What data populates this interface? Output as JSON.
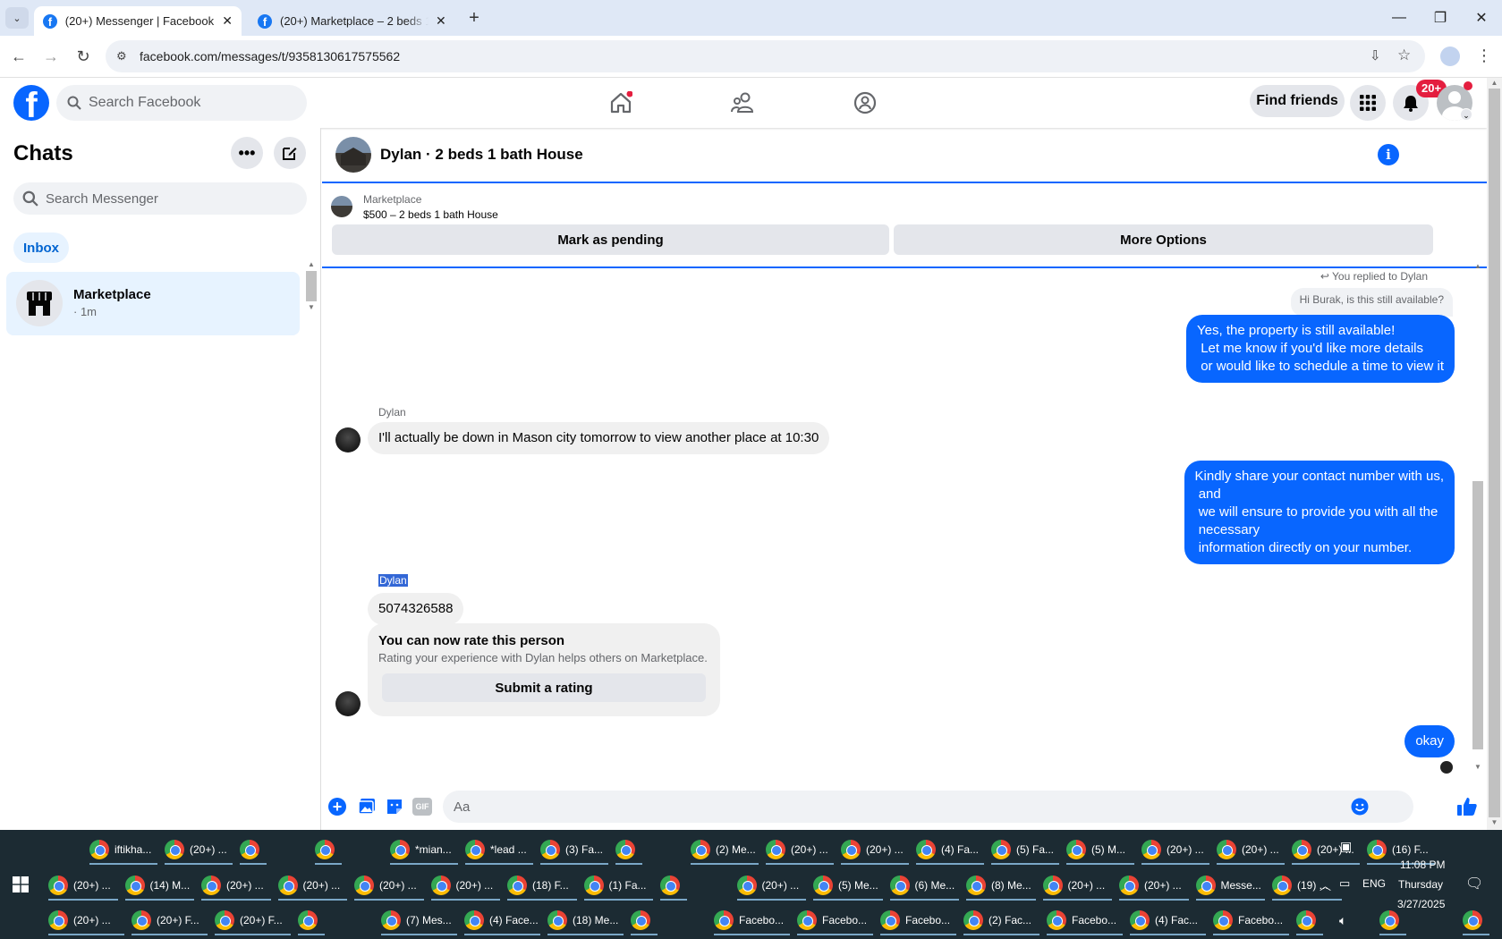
{
  "browser": {
    "tabs": [
      {
        "title": "(20+) Messenger | Facebook",
        "active": true
      },
      {
        "title": "(20+) Marketplace – 2 beds 1 bath House",
        "active": false
      }
    ],
    "url": "facebook.com/messages/t/9358130617575562"
  },
  "fb_header": {
    "search_placeholder": "Search Facebook",
    "find_friends": "Find friends",
    "notification_badge": "20+"
  },
  "sidebar": {
    "title": "Chats",
    "search_placeholder": "Search Messenger",
    "filter": "Inbox",
    "conversations": [
      {
        "name": "Marketplace",
        "time": "· 1m"
      }
    ]
  },
  "chat": {
    "title": "Dylan · 2 beds 1 bath House",
    "listing": {
      "label": "Marketplace",
      "price_title": "$500 – 2 beds 1 bath House",
      "mark_pending": "Mark as pending",
      "more_options": "More Options"
    },
    "messages": {
      "replied_to": "You replied to Dylan",
      "quoted": "Hi Burak, is this still available?",
      "out1": "Yes, the property is still available!\n Let me know if you'd like more details\n or would like to schedule a time to view it",
      "sender1": "Dylan",
      "in1": "I'll actually be down in Mason city tomorrow to view another place at 10:30",
      "out2": "Kindly share your contact number with us,\n and\n we will ensure to provide you with all the\n necessary\n information directly on your number.",
      "sender2": "Dylan",
      "in2": "5074326588",
      "rate_title": "You can now rate this person",
      "rate_desc": "Rating your experience with Dylan helps others on Marketplace.",
      "rate_button": "Submit a rating",
      "out3": "okay"
    },
    "composer_placeholder": "Aa",
    "gif_label": "GIF"
  },
  "taskbar": {
    "row1": [
      "iftikha...",
      "(20+) ...",
      "",
      "",
      "*mian...",
      "*lead ...",
      "(3) Fa...",
      "",
      "(2) Me...",
      "(20+) ...",
      "(20+) ...",
      "(4) Fa...",
      "(5) Fa...",
      "(5) M...",
      "(20+) ...",
      "(20+) ...",
      "(20+) ...",
      "(16) F..."
    ],
    "row2": [
      "(20+) ...",
      "(14) M...",
      "(20+) ...",
      "(20+) ...",
      "(20+) ...",
      "(20+) ...",
      "(18) F...",
      "(1) Fa...",
      "",
      "(20+) ...",
      "(5) Me...",
      "(6) Me...",
      "(8) Me...",
      "(20+) ...",
      "(20+) ...",
      "Messe...",
      "(19) ..."
    ],
    "row3": [
      "(20+) ...",
      "(20+) F...",
      "(20+) F...",
      "",
      "(7) Mes...",
      "(4) Face...",
      "(18) Me...",
      "",
      "Facebo...",
      "Facebo...",
      "Facebo...",
      "(2) Fac...",
      "Facebo...",
      "(4) Fac...",
      "Facebo...",
      "",
      "",
      ""
    ],
    "clock": {
      "time": "11:08 PM",
      "day": "Thursday",
      "date": "3/27/2025"
    },
    "lang": "ENG"
  }
}
